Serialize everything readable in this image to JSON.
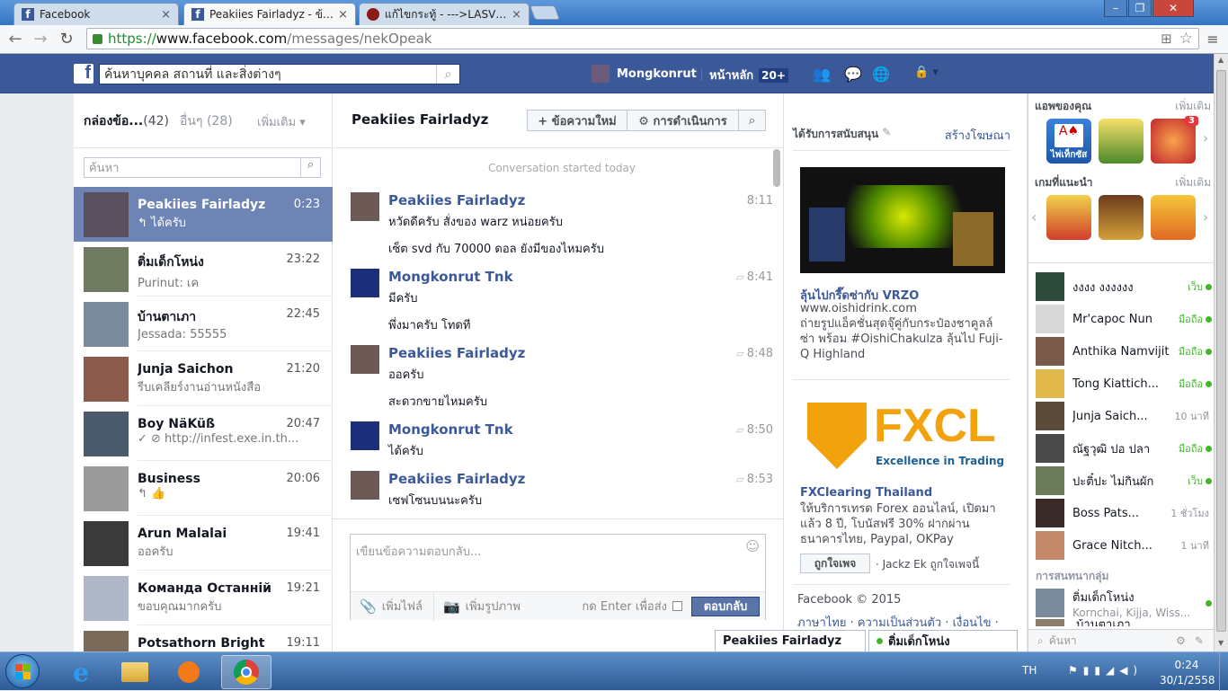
{
  "browser": {
    "tabs": [
      {
        "title": "Facebook",
        "close": "×"
      },
      {
        "title": "Peakiies Fairladyz - ข้อความ",
        "close": "×"
      },
      {
        "title": "แก้ไขกระทู้ - --->LASVEGAS",
        "close": "×"
      }
    ],
    "url_scheme": "https://",
    "url_host": "www.facebook.com",
    "url_path": "/messages/nekOpeak",
    "window_controls": [
      "–",
      "❐",
      "✕"
    ]
  },
  "fb_header": {
    "search_placeholder": "ค้นหาบุคคล สถานที่ และสิ่งต่างๆ",
    "profile_name": "Mongkonrut",
    "home_label": "หน้าหลัก",
    "home_count": "20+"
  },
  "inbox": {
    "tab_inbox": "กล่องข้อ...",
    "tab_inbox_count": "(42)",
    "tab_other": "อื่นๆ",
    "tab_other_count": "(28)",
    "more": "เพิ่มเติม",
    "search_placeholder": "ค้นหา",
    "conversations": [
      {
        "name": "Peakiies Fairladyz",
        "time": "0:23",
        "snippet": "↰ ได้ครับ",
        "selected": true
      },
      {
        "name": "ติ่มเด็กโหน่ง",
        "time": "23:22",
        "snippet": "Purinut: เค"
      },
      {
        "name": "บ้านตาเภา",
        "time": "22:45",
        "snippet": "Jessada: 55555"
      },
      {
        "name": "Junja Saichon",
        "time": "21:20",
        "snippet": "รีบเคลียร์งานอ่านหนังสือ"
      },
      {
        "name": "Boy NäKüß",
        "time": "20:47",
        "snippet": "✓ ⊘ http://infest.exe.in.th..."
      },
      {
        "name": "Business",
        "time": "20:06",
        "snippet": "↰ 👍"
      },
      {
        "name": "Arun Malalai",
        "time": "19:41",
        "snippet": "ออครับ"
      },
      {
        "name": "Команда Останній",
        "time": "19:21",
        "snippet": "ขอบคุณมากครับ"
      },
      {
        "name": "Potsathorn Bright",
        "time": "19:11",
        "snippet": ""
      }
    ]
  },
  "thread": {
    "title": "Peakiies Fairladyz",
    "new_message_btn": "+ ข้อความใหม่",
    "actions_btn": "⚙ การดำเนินการ",
    "started": "Conversation started today",
    "messages": [
      {
        "sender": "Peakiies Fairladyz",
        "time": "8:11",
        "lines": [
          "หวัดดีครับ สั่งของ warz หน่อยครับ",
          "เซ็ต svd กับ 70000 ดอล ยังมีของไหมครับ"
        ]
      },
      {
        "sender": "Mongkonrut Tnk",
        "time": "8:41",
        "lines": [
          "มีครับ",
          "พึ่งมาครับ โทดที"
        ]
      },
      {
        "sender": "Peakiies Fairladyz",
        "time": "8:48",
        "lines": [
          "ออครับ",
          "สะดวกขายไหมครับ"
        ]
      },
      {
        "sender": "Mongkonrut Tnk",
        "time": "8:50",
        "lines": [
          "ได้ครับ"
        ]
      },
      {
        "sender": "Peakiies Fairladyz",
        "time": "8:53",
        "lines": [
          "เซฟโซนบนนะครับ"
        ]
      }
    ],
    "reply_placeholder": "เขียนข้อความตอบกลับ...",
    "add_files": "เพิ่มไฟล์",
    "add_photos": "เพิ่มรูปภาพ",
    "enter_to_send": "กด Enter เพื่อส่ง",
    "reply_btn": "ตอบกลับ"
  },
  "ads": {
    "sponsored": "ได้รับการสนับสนุน",
    "create_ad": "สร้างโฆษณา",
    "ad1": {
      "title": "ลุ้นไปกรี๊ดซ่ากับ VRZO",
      "url": "www.oishidrink.com",
      "body": "ถ่ายรูปแอ็คชั่นสุดจุ๊คู่กับกระป๋องชาคูลล์ซ่า พร้อม #OishiChakulza ลุ้นไป Fuji-Q Highland"
    },
    "ad2": {
      "logo_text": "FXCL",
      "logo_tagline": "Excellence in Trading",
      "title": "FXClearing Thailand",
      "body": "ให้บริการเทรด Forex ออนไลน์, เปิดมาแล้ว 8 ปี, โบนัสฟรี 30% ฝากผ่านธนาคารไทย, Paypal, OKPay",
      "like_btn": "ถูกใจเพจ",
      "social": "· Jackz Ek ถูกใจเพจนี้"
    },
    "footer_copyright": "Facebook © 2015",
    "footer_links": "ภาษาไทย · ความเป็นส่วนตัว · เงื่อนไข ·"
  },
  "sidebar": {
    "your_apps": "แอพของคุณ",
    "more": "เพิ่มเติม",
    "recommended_games": "เกมที่แนะนำ",
    "apps": [
      {
        "label": "ไพ่เท็กซัส"
      },
      {
        "label": ""
      },
      {
        "label": "",
        "badge": "3"
      }
    ],
    "friends": [
      {
        "name": "งงงง งงงงงง",
        "status": "เว็บ"
      },
      {
        "name": "Mr'capoc Nun",
        "status": "มือถือ"
      },
      {
        "name": "Anthika Namvijit",
        "status": "มือถือ"
      },
      {
        "name": "Tong Kiattich...",
        "status": "มือถือ"
      },
      {
        "name": "Junja Saich...",
        "status": "10 นาที"
      },
      {
        "name": "ณัฐวุฒิ ปอ ปลา",
        "status": "มือถือ"
      },
      {
        "name": "ปะติ๋ปะ ไม่กินผัก",
        "status": "เว็บ"
      },
      {
        "name": "Boss Pats...",
        "status": "1 ชั่วโมง"
      },
      {
        "name": "Grace Nitch...",
        "status": "1 นาที"
      }
    ],
    "group_header": "การสนทนากลุ่ม",
    "group_name": "ติ่มเด็กโหน่ง",
    "group_members": "Kornchai, Kijja, Wiss...",
    "group2_name": "บ้านตาเภา",
    "search_placeholder": "ค้นหา"
  },
  "chat_tabs": [
    {
      "name": "Peakiies Fairladyz"
    },
    {
      "name": "ติ่มเด็กโหน่ง"
    }
  ],
  "taskbar": {
    "lang": "TH",
    "time": "0:24",
    "date": "30/1/2558"
  }
}
